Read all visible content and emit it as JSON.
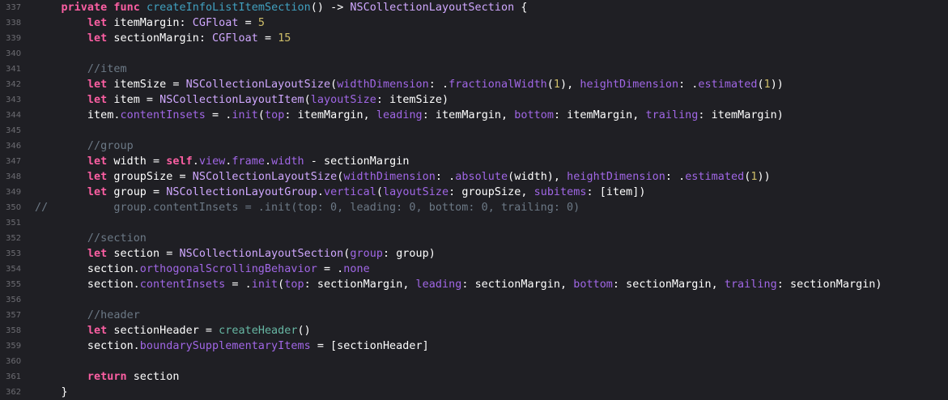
{
  "editor": {
    "lines": [
      {
        "num": "337",
        "tokens": [
          {
            "t": "    "
          },
          {
            "t": "private",
            "c": "kw"
          },
          {
            "t": " "
          },
          {
            "t": "func",
            "c": "kw"
          },
          {
            "t": " "
          },
          {
            "t": "createInfoListItemSection",
            "c": "fn"
          },
          {
            "t": "() -> "
          },
          {
            "t": "NSCollectionLayoutSection",
            "c": "type"
          },
          {
            "t": " {"
          }
        ]
      },
      {
        "num": "338",
        "tokens": [
          {
            "t": "        "
          },
          {
            "t": "let",
            "c": "kw"
          },
          {
            "t": " itemMargin: "
          },
          {
            "t": "CGFloat",
            "c": "type"
          },
          {
            "t": " = "
          },
          {
            "t": "5",
            "c": "num"
          }
        ]
      },
      {
        "num": "339",
        "tokens": [
          {
            "t": "        "
          },
          {
            "t": "let",
            "c": "kw"
          },
          {
            "t": " sectionMargin: "
          },
          {
            "t": "CGFloat",
            "c": "type"
          },
          {
            "t": " = "
          },
          {
            "t": "15",
            "c": "num"
          }
        ]
      },
      {
        "num": "340",
        "tokens": []
      },
      {
        "num": "341",
        "tokens": [
          {
            "t": "        "
          },
          {
            "t": "//item",
            "c": "cm"
          }
        ]
      },
      {
        "num": "342",
        "tokens": [
          {
            "t": "        "
          },
          {
            "t": "let",
            "c": "kw"
          },
          {
            "t": " itemSize = "
          },
          {
            "t": "NSCollectionLayoutSize",
            "c": "type"
          },
          {
            "t": "("
          },
          {
            "t": "widthDimension",
            "c": "prop"
          },
          {
            "t": ": ."
          },
          {
            "t": "fractionalWidth",
            "c": "prop"
          },
          {
            "t": "("
          },
          {
            "t": "1",
            "c": "num"
          },
          {
            "t": "), "
          },
          {
            "t": "heightDimension",
            "c": "prop"
          },
          {
            "t": ": ."
          },
          {
            "t": "estimated",
            "c": "prop"
          },
          {
            "t": "("
          },
          {
            "t": "1",
            "c": "num"
          },
          {
            "t": "))"
          }
        ]
      },
      {
        "num": "343",
        "tokens": [
          {
            "t": "        "
          },
          {
            "t": "let",
            "c": "kw"
          },
          {
            "t": " item = "
          },
          {
            "t": "NSCollectionLayoutItem",
            "c": "type"
          },
          {
            "t": "("
          },
          {
            "t": "layoutSize",
            "c": "prop"
          },
          {
            "t": ": itemSize)"
          }
        ]
      },
      {
        "num": "344",
        "tokens": [
          {
            "t": "        item."
          },
          {
            "t": "contentInsets",
            "c": "prop"
          },
          {
            "t": " = ."
          },
          {
            "t": "init",
            "c": "prop"
          },
          {
            "t": "("
          },
          {
            "t": "top",
            "c": "prop"
          },
          {
            "t": ": itemMargin, "
          },
          {
            "t": "leading",
            "c": "prop"
          },
          {
            "t": ": itemMargin, "
          },
          {
            "t": "bottom",
            "c": "prop"
          },
          {
            "t": ": itemMargin, "
          },
          {
            "t": "trailing",
            "c": "prop"
          },
          {
            "t": ": itemMargin)"
          }
        ]
      },
      {
        "num": "345",
        "tokens": []
      },
      {
        "num": "346",
        "tokens": [
          {
            "t": "        "
          },
          {
            "t": "//group",
            "c": "cm"
          }
        ]
      },
      {
        "num": "347",
        "tokens": [
          {
            "t": "        "
          },
          {
            "t": "let",
            "c": "kw"
          },
          {
            "t": " width = "
          },
          {
            "t": "self",
            "c": "kw"
          },
          {
            "t": "."
          },
          {
            "t": "view",
            "c": "prop"
          },
          {
            "t": "."
          },
          {
            "t": "frame",
            "c": "prop"
          },
          {
            "t": "."
          },
          {
            "t": "width",
            "c": "prop"
          },
          {
            "t": " - sectionMargin"
          }
        ]
      },
      {
        "num": "348",
        "tokens": [
          {
            "t": "        "
          },
          {
            "t": "let",
            "c": "kw"
          },
          {
            "t": " groupSize = "
          },
          {
            "t": "NSCollectionLayoutSize",
            "c": "type"
          },
          {
            "t": "("
          },
          {
            "t": "widthDimension",
            "c": "prop"
          },
          {
            "t": ": ."
          },
          {
            "t": "absolute",
            "c": "prop"
          },
          {
            "t": "(width), "
          },
          {
            "t": "heightDimension",
            "c": "prop"
          },
          {
            "t": ": ."
          },
          {
            "t": "estimated",
            "c": "prop"
          },
          {
            "t": "("
          },
          {
            "t": "1",
            "c": "num"
          },
          {
            "t": "))"
          }
        ]
      },
      {
        "num": "349",
        "tokens": [
          {
            "t": "        "
          },
          {
            "t": "let",
            "c": "kw"
          },
          {
            "t": " group = "
          },
          {
            "t": "NSCollectionLayoutGroup",
            "c": "type"
          },
          {
            "t": "."
          },
          {
            "t": "vertical",
            "c": "prop"
          },
          {
            "t": "("
          },
          {
            "t": "layoutSize",
            "c": "prop"
          },
          {
            "t": ": groupSize, "
          },
          {
            "t": "subitems",
            "c": "prop"
          },
          {
            "t": ": [item])"
          }
        ]
      },
      {
        "num": "350",
        "tokens": [
          {
            "t": "//          group.contentInsets = .init(top: 0, leading: 0, bottom: 0, trailing: 0)",
            "c": "cm"
          }
        ]
      },
      {
        "num": "351",
        "tokens": []
      },
      {
        "num": "352",
        "tokens": [
          {
            "t": "        "
          },
          {
            "t": "//section",
            "c": "cm"
          }
        ]
      },
      {
        "num": "353",
        "tokens": [
          {
            "t": "        "
          },
          {
            "t": "let",
            "c": "kw"
          },
          {
            "t": " section = "
          },
          {
            "t": "NSCollectionLayoutSection",
            "c": "type"
          },
          {
            "t": "("
          },
          {
            "t": "group",
            "c": "prop"
          },
          {
            "t": ": group)"
          }
        ]
      },
      {
        "num": "354",
        "tokens": [
          {
            "t": "        section."
          },
          {
            "t": "orthogonalScrollingBehavior",
            "c": "prop"
          },
          {
            "t": " = ."
          },
          {
            "t": "none",
            "c": "prop"
          }
        ]
      },
      {
        "num": "355",
        "tokens": [
          {
            "t": "        section."
          },
          {
            "t": "contentInsets",
            "c": "prop"
          },
          {
            "t": " = ."
          },
          {
            "t": "init",
            "c": "prop"
          },
          {
            "t": "("
          },
          {
            "t": "top",
            "c": "prop"
          },
          {
            "t": ": sectionMargin, "
          },
          {
            "t": "leading",
            "c": "prop"
          },
          {
            "t": ": sectionMargin, "
          },
          {
            "t": "bottom",
            "c": "prop"
          },
          {
            "t": ": sectionMargin, "
          },
          {
            "t": "trailing",
            "c": "prop"
          },
          {
            "t": ": sectionMargin)"
          }
        ]
      },
      {
        "num": "356",
        "tokens": []
      },
      {
        "num": "357",
        "tokens": [
          {
            "t": "        "
          },
          {
            "t": "//header",
            "c": "cm"
          }
        ]
      },
      {
        "num": "358",
        "tokens": [
          {
            "t": "        "
          },
          {
            "t": "let",
            "c": "kw"
          },
          {
            "t": " sectionHeader = "
          },
          {
            "t": "createHeader",
            "c": "call"
          },
          {
            "t": "()"
          }
        ]
      },
      {
        "num": "359",
        "tokens": [
          {
            "t": "        section."
          },
          {
            "t": "boundarySupplementaryItems",
            "c": "prop"
          },
          {
            "t": " = [sectionHeader]"
          }
        ]
      },
      {
        "num": "360",
        "tokens": []
      },
      {
        "num": "361",
        "tokens": [
          {
            "t": "        "
          },
          {
            "t": "return",
            "c": "kw"
          },
          {
            "t": " section"
          }
        ]
      },
      {
        "num": "362",
        "tokens": [
          {
            "t": "    }"
          }
        ]
      }
    ]
  }
}
